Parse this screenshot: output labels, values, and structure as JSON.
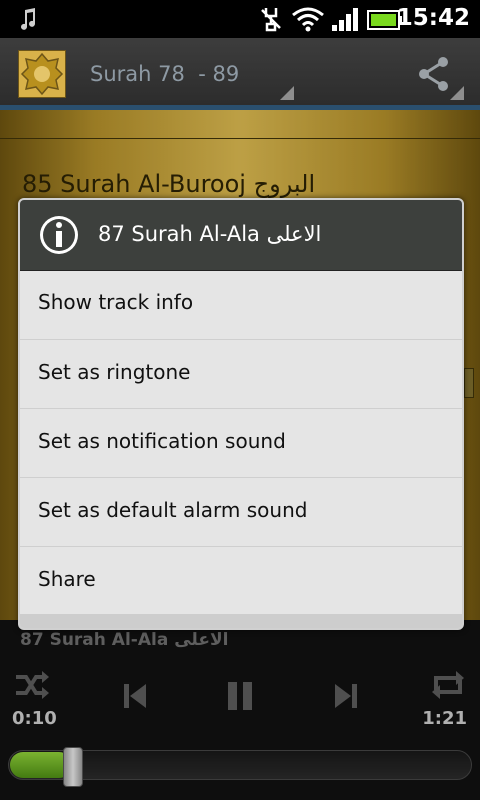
{
  "status_bar": {
    "time": "15:42",
    "icons": [
      "music-note-icon",
      "usb-debug-icon",
      "wifi-icon",
      "signal-icon",
      "battery-icon"
    ]
  },
  "action_bar": {
    "title": "Surah 78  - 89",
    "app_icon": "quran-icon",
    "share_icon": "share-icon"
  },
  "background_list": {
    "visible_track": "85 Surah Al-Burooj  البروج"
  },
  "dialog": {
    "title": "87 Surah Al-Ala الاعلى",
    "items": [
      {
        "label": "Show track info"
      },
      {
        "label": "Set as ringtone"
      },
      {
        "label": "Set as notification sound"
      },
      {
        "label": "Set as default alarm sound"
      },
      {
        "label": "Share"
      }
    ]
  },
  "player": {
    "now_playing": "87 Surah Al-Ala الاعلى",
    "elapsed": "0:10",
    "duration": "1:21",
    "progress": 0.135
  },
  "colors": {
    "accent": "#2a4f6e",
    "progress": "#6bb024",
    "dialog_header": "#3d403d"
  }
}
